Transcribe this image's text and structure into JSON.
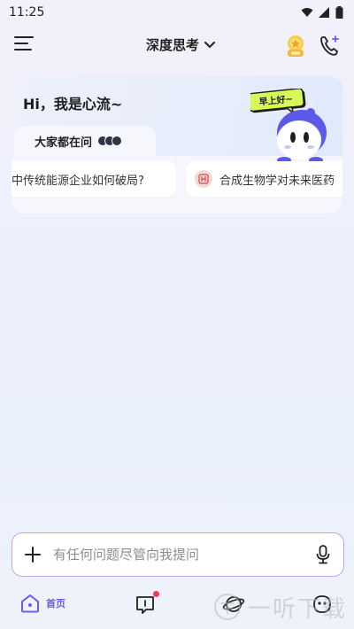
{
  "status_bar": {
    "time": "11:25"
  },
  "header": {
    "mode_label": "深度思考"
  },
  "hero": {
    "greeting": "Hi，我是心流~",
    "ask_label": "大家都在问",
    "mascot_bubble": "早上好~",
    "suggestions": [
      {
        "text": "中传统能源企业如何破局?"
      },
      {
        "text": "合成生物学对未来医药"
      }
    ]
  },
  "input": {
    "placeholder": "有任何问题尽管向我提问"
  },
  "bottom_nav": {
    "home_label": "首页"
  },
  "watermark": {
    "text": "一听下载"
  },
  "colors": {
    "accent": "#6b5cf0",
    "input_border": "#b9a8f0",
    "notification_dot": "#ef3b4d",
    "mascot_body": "#5b59e8"
  }
}
